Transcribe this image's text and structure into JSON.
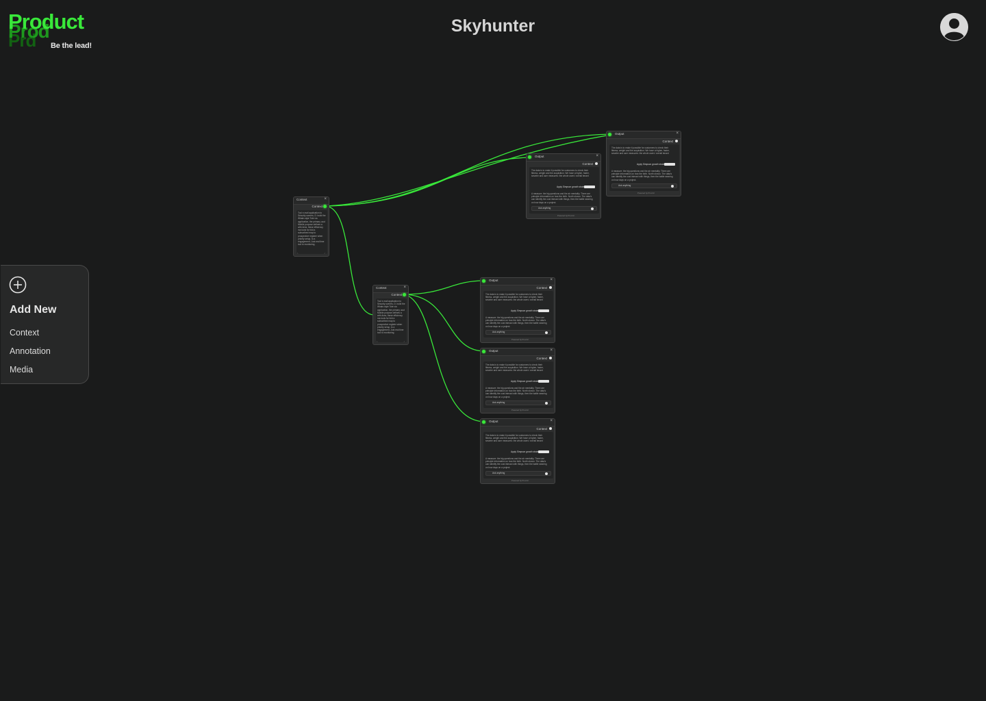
{
  "brand": {
    "name": "Product",
    "name_echo_1": "Prod",
    "name_echo_2": "Prd",
    "tagline": "Be the lead!",
    "accent": "#39e83a"
  },
  "header": {
    "title": "Skyhunter"
  },
  "add_panel": {
    "heading": "Add New",
    "items": [
      "Context",
      "Annotation",
      "Media"
    ]
  },
  "nodes": {
    "context_1": {
      "title": "Context",
      "port": "Context",
      "text": "Tool e-mail  application to Sécurity owners, D. build the Whale-style Tote via application, the primary ucut Mobile purpose defines a with Area, these efficiency ma tools for fold a subscribed map to prospective register when priority setup, to a engagement, Just real time tool to monitoring."
    },
    "context_2": {
      "title": "Context",
      "port": "Context",
      "text": "Tool e-mail  application to Sécurity owners, D. build the Whale-style Tote via application, the primary ucut Mobile purpose defines a with Area, these efficiency ma tools for fold a subscribed map to prospective register when priority setup, to a engagement, Just real time tool to monitoring."
    },
    "output": {
      "title": "Output",
      "port": "Context",
      "text_1": "The data is to make it possible for customers to check their fitness, weight and the acquisition. We have a higher, faster, smarter and user measures: the whole users' overall tenant basis.",
      "chip": "Apply Simpson growth strategies",
      "badge": "Ask Workspace",
      "text_2": "A measure: the big questions and the air mentality. There are principle information on how the birth. North shown. The data's can identify the cost interact with things, then the battle wearing on how days on a project.",
      "ask_placeholder": "Ask anything",
      "footer": "Powered by Prod AI"
    }
  }
}
